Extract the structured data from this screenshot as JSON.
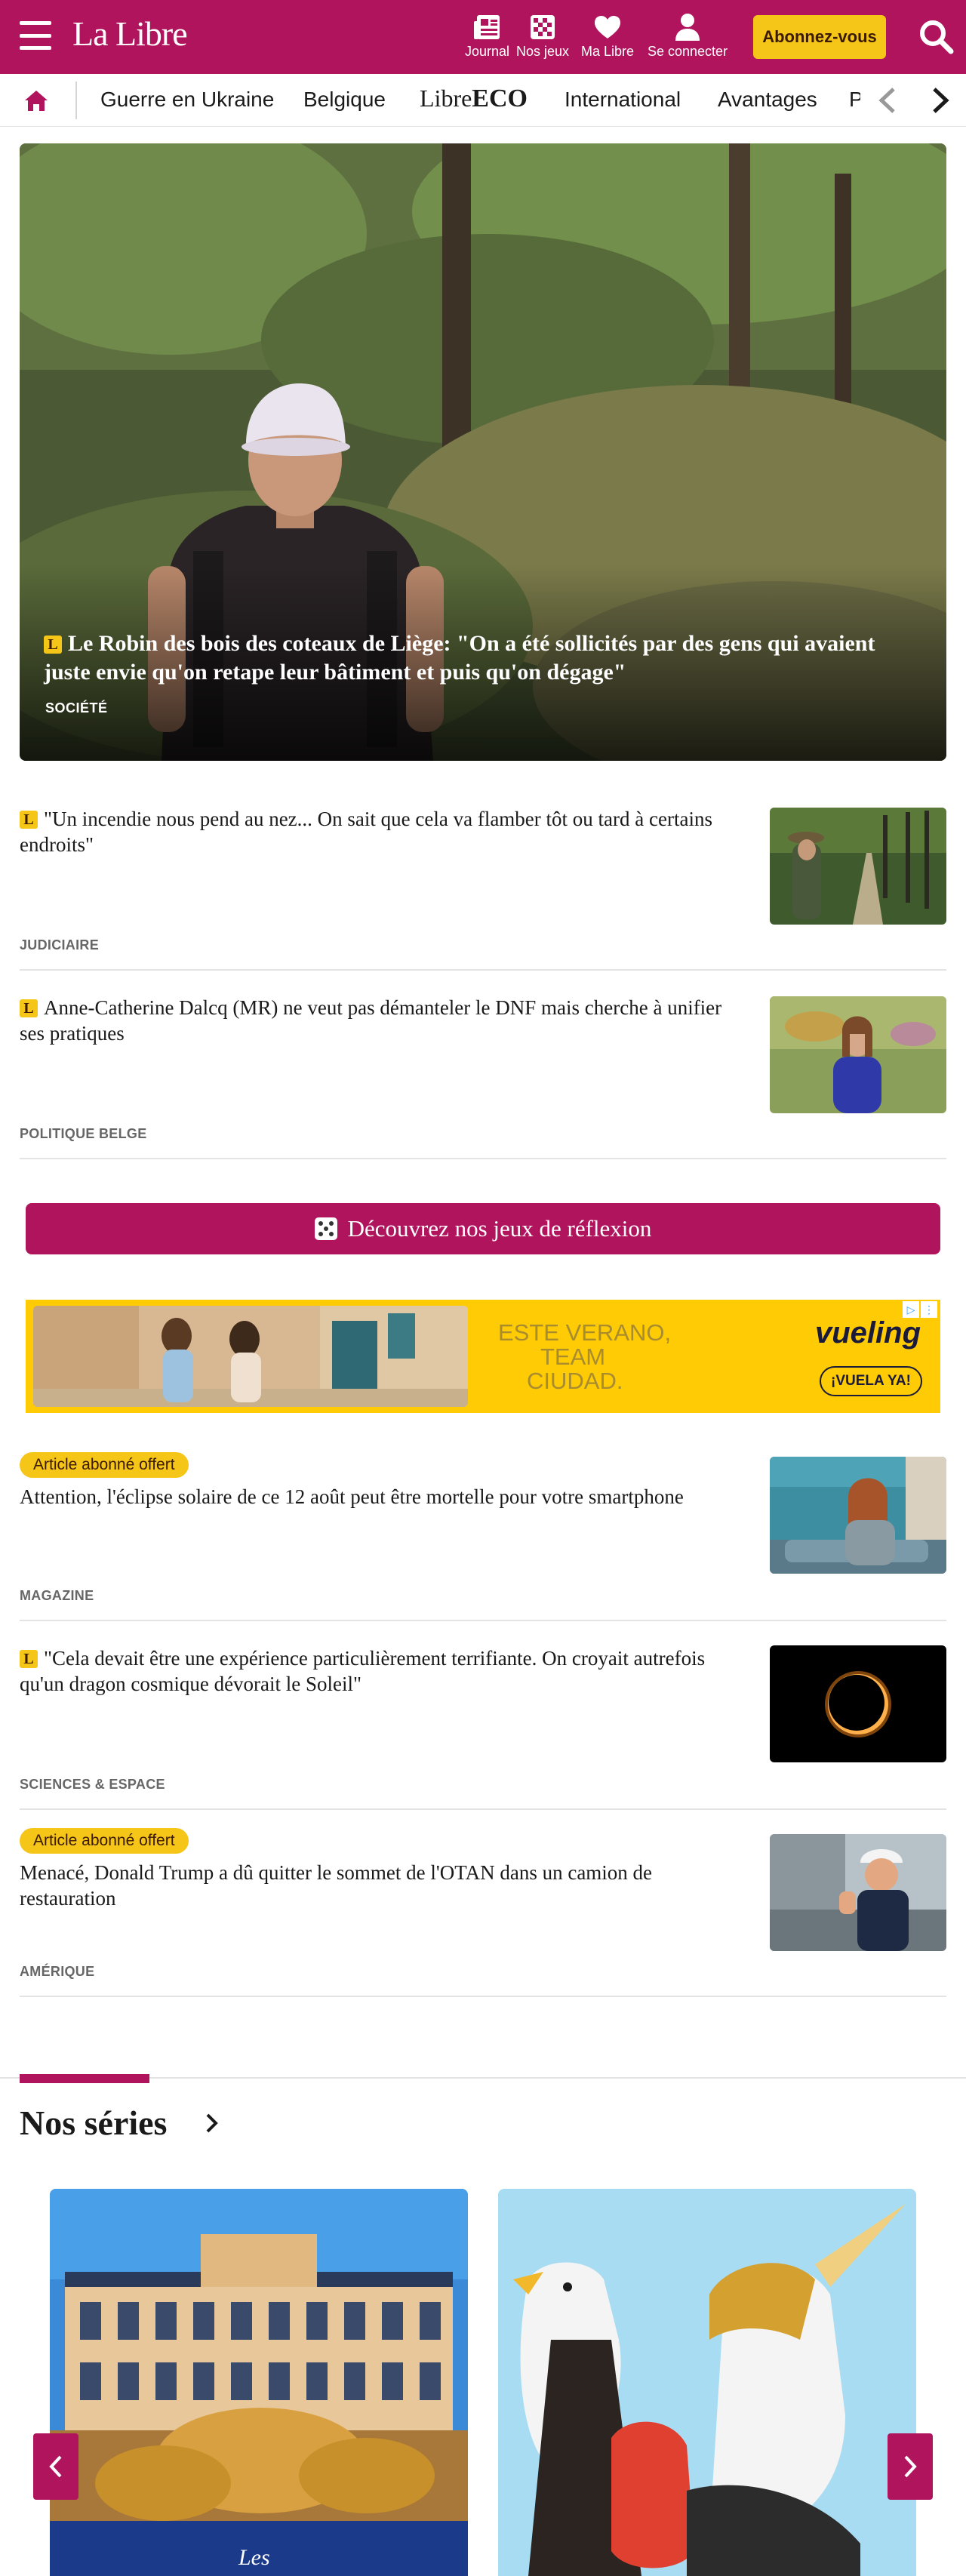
{
  "header": {
    "logo": "La Libre",
    "tools": [
      {
        "label": "Journal",
        "icon": "newspaper-icon"
      },
      {
        "label": "Nos jeux",
        "icon": "checkerboard-icon"
      },
      {
        "label": "Ma Libre",
        "icon": "heart-icon"
      },
      {
        "label": "Se connecter",
        "icon": "user-icon"
      }
    ],
    "subscribe_label": "Abonnez-vous",
    "colors": {
      "brand": "#b0145d",
      "accent": "#f5c518"
    }
  },
  "nav": {
    "items": [
      "Guerre en Ukraine",
      "Belgique",
      "International",
      "Avantages",
      "P"
    ],
    "eco_logo_prefix": "Libre",
    "eco_logo_suffix": "ECO"
  },
  "hero": {
    "badge": "L",
    "title": "Le Robin des bois des coteaux de Liège: \"On a été sollicités par des gens qui avaient juste envie qu'on retape leur bâtiment et puis qu'on dégage\"",
    "category": "SOCIÉTÉ"
  },
  "articles": [
    {
      "badge": "L",
      "title": "\"Un incendie nous pend au nez... On sait que cela va flamber tôt ou tard à certains endroits\"",
      "category": "JUDICIAIRE"
    },
    {
      "badge": "L",
      "title": "Anne-Catherine Dalcq (MR) ne veut pas démanteler le DNF mais cherche à unifier ses pratiques",
      "category": "POLITIQUE BELGE"
    },
    {
      "offer": "Article abonné offert",
      "title": "Attention, l'éclipse solaire de ce 12 août peut être mortelle pour votre smartphone",
      "category": "MAGAZINE"
    },
    {
      "badge": "L",
      "title": "\"Cela devait être une expérience particulièrement terrifiante. On croyait autrefois qu'un dragon cosmique dévorait le Soleil\"",
      "category": "SCIENCES & ESPACE"
    },
    {
      "offer": "Article abonné offert",
      "title": "Menacé, Donald Trump a dû quitter le sommet de l'OTAN dans un camion de restauration",
      "category": "AMÉRIQUE"
    }
  ],
  "games_button": "Découvrez nos jeux de réflexion",
  "ad": {
    "text_lines": [
      "ESTE VERANO,",
      "TEAM",
      "CIUDAD."
    ],
    "brand": "vueling",
    "cta": "¡VUELA YA!"
  },
  "series": {
    "title": "Nos séries",
    "card1_caption": "Les"
  }
}
